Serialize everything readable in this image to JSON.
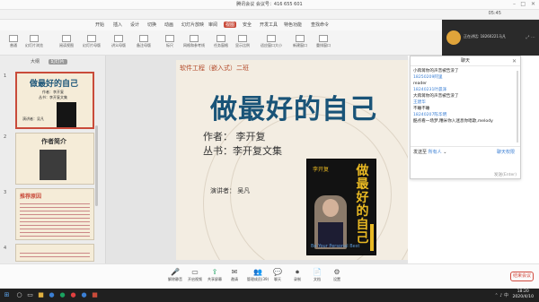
{
  "meeting": {
    "title": "腾讯会议 会议号：416 655 601",
    "timer": "05:45"
  },
  "ribbon_tabs": [
    {
      "label": "开始",
      "active": false
    },
    {
      "label": "插入",
      "active": false
    },
    {
      "label": "设计",
      "active": false
    },
    {
      "label": "切换",
      "active": false
    },
    {
      "label": "动画",
      "active": false
    },
    {
      "label": "幻灯片放映",
      "active": false
    },
    {
      "label": "审阅",
      "active": false
    },
    {
      "label": "视图",
      "active": true
    },
    {
      "label": "安全",
      "active": false
    },
    {
      "label": "开发工具",
      "active": false
    },
    {
      "label": "特色功能",
      "active": false
    },
    {
      "label": "查找命令",
      "active": false
    }
  ],
  "ribbon_buttons": [
    {
      "label": "普通"
    },
    {
      "label": "幻灯片浏览"
    },
    {
      "label": "阅读视图"
    },
    {
      "label": "幻灯片母版"
    },
    {
      "label": "讲义母版"
    },
    {
      "label": "备注母版"
    },
    {
      "label": "标尺"
    },
    {
      "label": "网格和参考线"
    },
    {
      "label": "任务窗格"
    },
    {
      "label": "显示比例"
    },
    {
      "label": "适应窗口大小"
    },
    {
      "label": "新建窗口"
    },
    {
      "label": "重排窗口"
    }
  ],
  "camera": {
    "name": "正在讲话: 18260221马凡"
  },
  "panel_tabs": [
    "大纲",
    "幻灯片"
  ],
  "thumbnails": [
    {
      "num": "1",
      "title": "做最好的自己",
      "lines": [
        "作者：李开复",
        "丛书：李开复文集",
        "演讲者：吴凡"
      ]
    },
    {
      "num": "2",
      "title": "作者简介"
    },
    {
      "num": "3",
      "title": "推荐原因"
    },
    {
      "num": "4",
      "title": ""
    }
  ],
  "slide": {
    "subtitle": "软件工程（嵌入式）二班",
    "title": "做最好的自己",
    "author": "作者：  李开复",
    "series": "丛书：李开复文集",
    "speaker": "演讲者：  吴凡",
    "book_title": "做最好的自己",
    "book_signature": "李开复",
    "book_english": "Be Your Personal Best"
  },
  "chat": {
    "header": "聊天",
    "messages": [
      {
        "type": "text",
        "text": "小蒋蒋你的声音被告没了"
      },
      {
        "type": "name",
        "text": "18250209阿里"
      },
      {
        "type": "text",
        "text": "reader"
      },
      {
        "type": "name",
        "text": "18240231叶晨泽"
      },
      {
        "type": "text",
        "text": "大蒋蒋你的声音被告没了"
      },
      {
        "type": "name",
        "text": "王建华"
      },
      {
        "type": "text",
        "text": "不睡不睡"
      },
      {
        "type": "name",
        "text": "18240207陈华明"
      },
      {
        "type": "text",
        "text": "酷点看一场梦,糟米你入迷息你唱歌,melody"
      }
    ],
    "send_to_label": "发送至",
    "send_to_value": "所有人",
    "permission": "聊天权限",
    "send_button": "发送(Enter)"
  },
  "meeting_toolbar": [
    {
      "label": "解除静音",
      "icon": "mic-icon",
      "glyph": "🎤"
    },
    {
      "label": "开启视频",
      "icon": "camera-icon",
      "glyph": "▭"
    },
    {
      "label": "共享屏幕",
      "icon": "share-screen-icon",
      "glyph": "⇪"
    },
    {
      "label": "邀请",
      "icon": "invite-icon",
      "glyph": "✉"
    },
    {
      "label": "管理成员(39)",
      "icon": "members-icon",
      "glyph": "👥"
    },
    {
      "label": "聊天",
      "icon": "chat-icon",
      "glyph": "💬"
    },
    {
      "label": "录制",
      "icon": "record-icon",
      "glyph": "⏺"
    },
    {
      "label": "文档",
      "icon": "document-icon",
      "glyph": "📄"
    },
    {
      "label": "设置",
      "icon": "settings-icon",
      "glyph": "⚙"
    }
  ],
  "end_meeting": "结束会议",
  "taskbar": {
    "time": "18:20",
    "date": "2020/4/10"
  }
}
